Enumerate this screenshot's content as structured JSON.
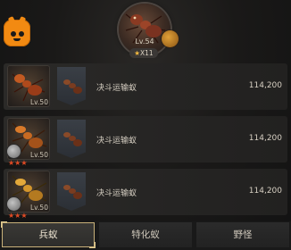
{
  "hero": {
    "level": "Lv.54",
    "stars": "X11",
    "icon": "red-ant-portrait"
  },
  "rows": [
    {
      "level": "Lv.50",
      "name": "决斗运输蚁",
      "power": "114,200",
      "stars": "",
      "icon": "fire-ant-thumb"
    },
    {
      "level": "Lv.50",
      "name": "决斗运输蚁",
      "power": "114,200",
      "stars": "★★★",
      "icon": "orange-ant-thumb"
    },
    {
      "level": "Lv.50",
      "name": "决斗运输蚁",
      "power": "114,200",
      "stars": "★★★",
      "icon": "yellow-ant-thumb"
    }
  ],
  "tabs": [
    {
      "label": "兵蚁",
      "active": true
    },
    {
      "label": "特化蚁",
      "active": false
    },
    {
      "label": "野怪",
      "active": false
    }
  ],
  "colors": {
    "accent": "#f28a12",
    "tab_border": "#c9b17a",
    "star_red": "#e04a24"
  }
}
